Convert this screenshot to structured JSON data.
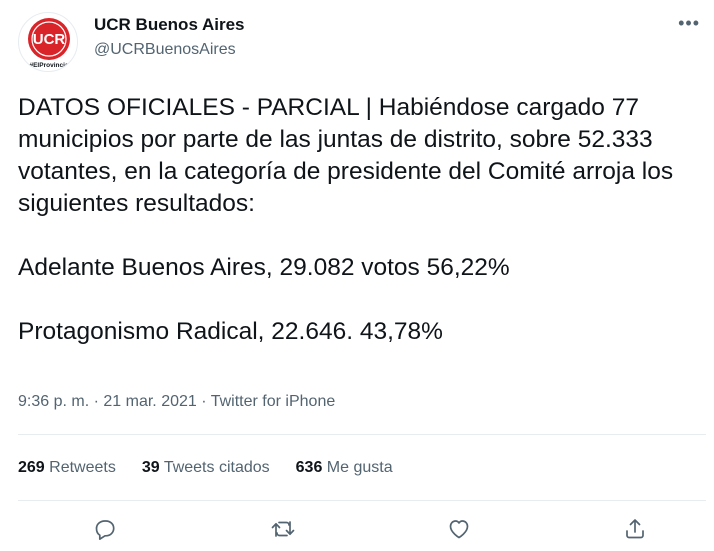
{
  "account": {
    "display_name": "UCR Buenos Aires",
    "handle": "@UCRBuenosAires",
    "avatar_text": "UCR",
    "avatar_subtext": "#ElProvincia"
  },
  "tweet": {
    "text": "DATOS OFICIALES - PARCIAL | Habiéndose cargado 77 municipios por parte de las juntas de distrito, sobre 52.333 votantes, en la categoría de presidente del Comité arroja los siguientes resultados:\n\nAdelante Buenos Aires, 29.082 votos 56,22%\n\nProtagonismo Radical, 22.646. 43,78%",
    "time": "9:36 p. m.",
    "date": "21 mar. 2021",
    "source": "Twitter for iPhone",
    "separator": "·"
  },
  "stats": {
    "retweets_count": "269",
    "retweets_label": "Retweets",
    "quotes_count": "39",
    "quotes_label": "Tweets citados",
    "likes_count": "636",
    "likes_label": "Me gusta"
  },
  "actions": [
    "reply-icon",
    "retweet-icon",
    "like-icon",
    "share-icon"
  ],
  "colors": {
    "text": "#0f1419",
    "secondary": "#536471",
    "divider": "#e6ecf0",
    "ucr_red": "#d9252a"
  }
}
